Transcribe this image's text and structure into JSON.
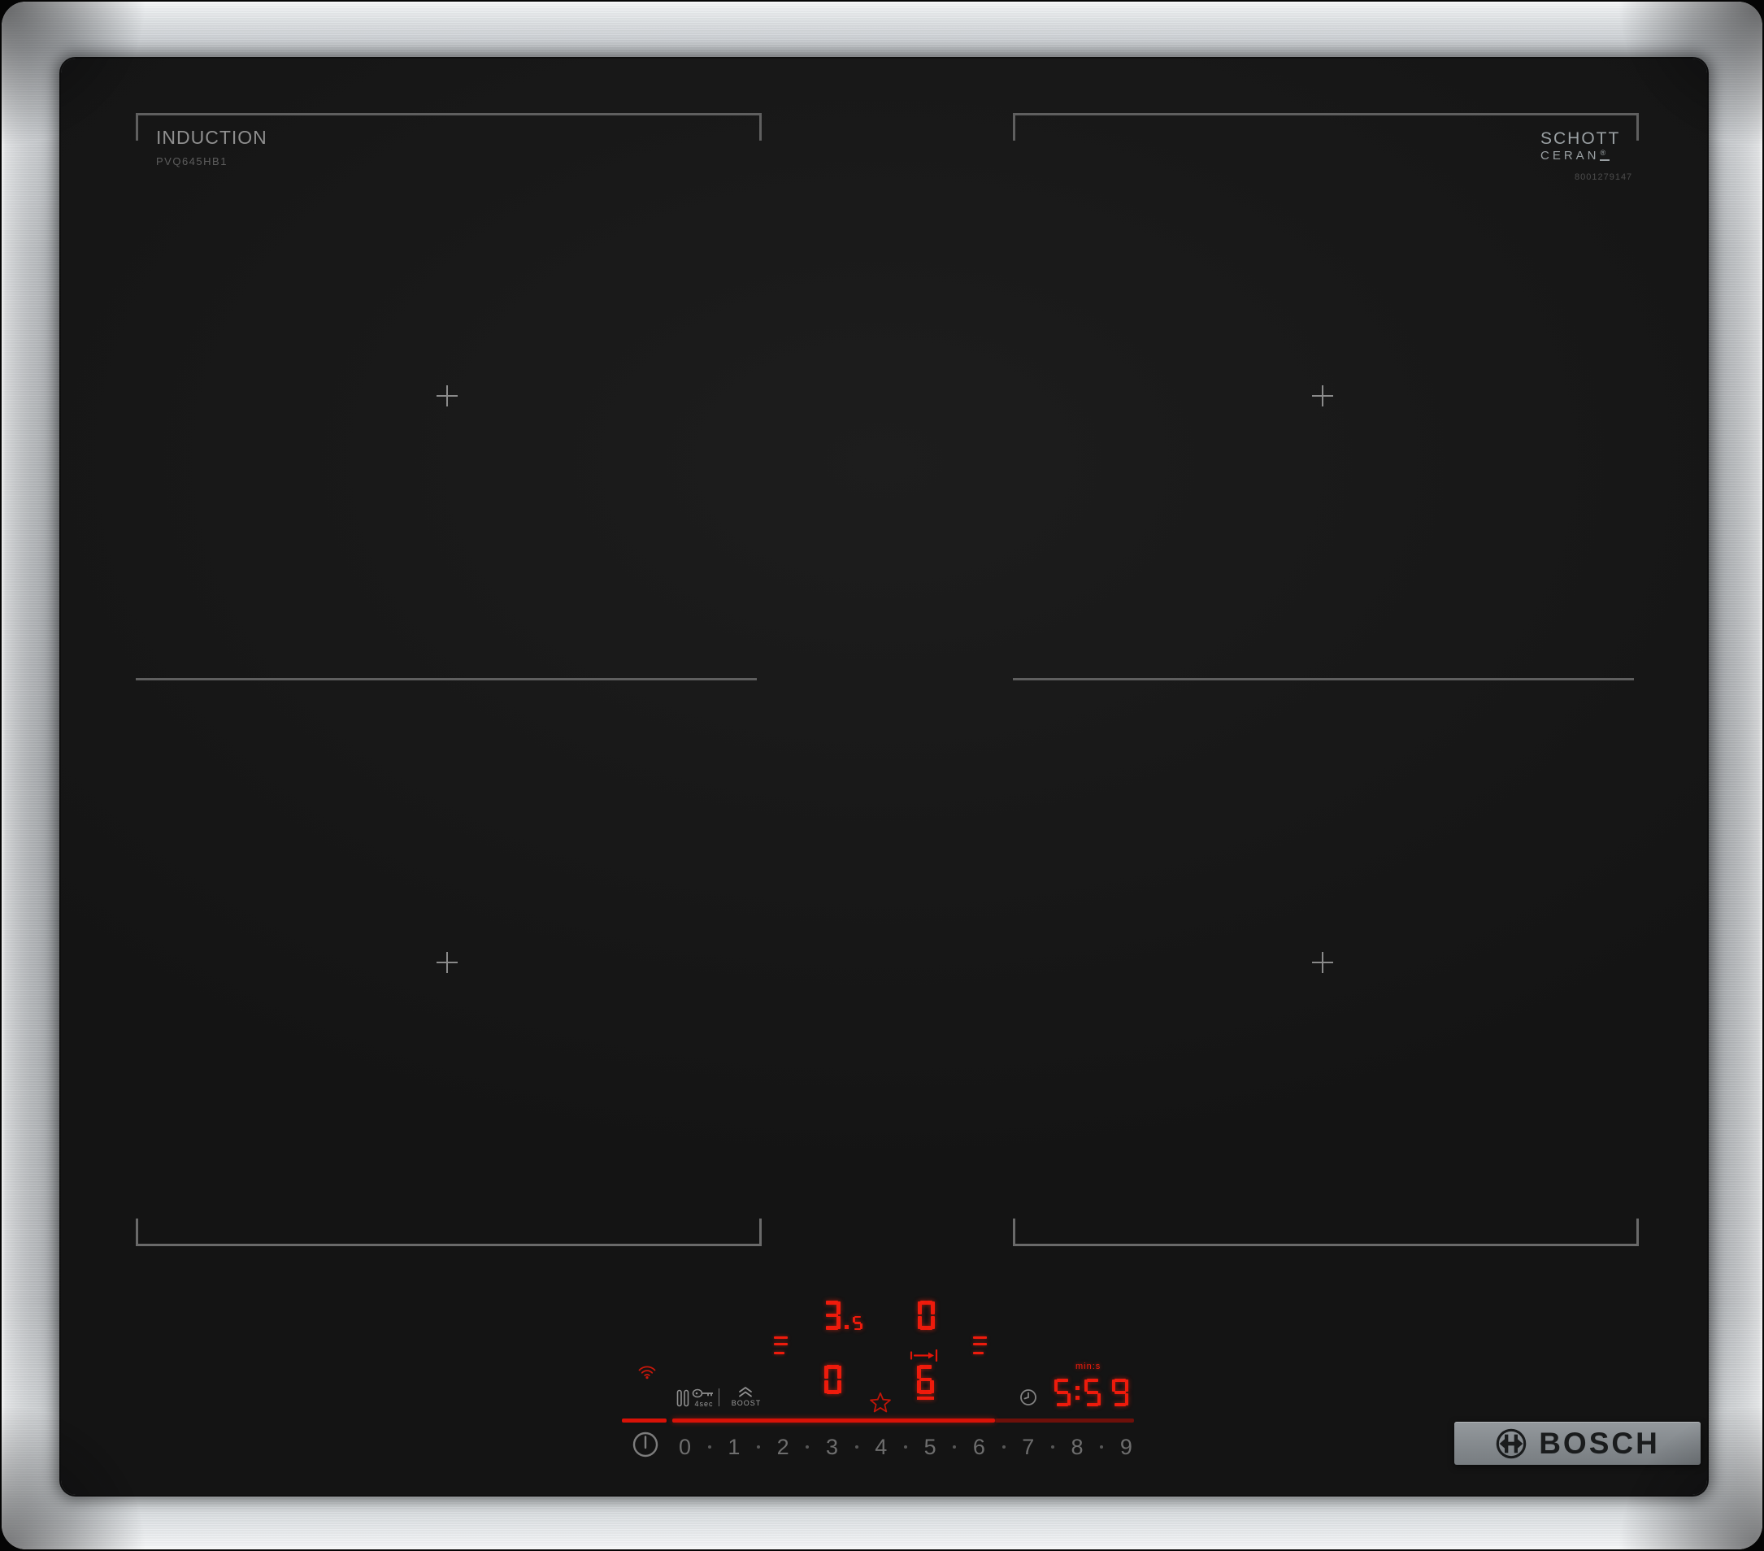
{
  "product": {
    "type_label": "INDUCTION",
    "model": "PVQ645HB1",
    "glass_brand_line1": "SCHOTT",
    "glass_brand_line2": "CERAN",
    "glass_brand_reg": "®",
    "print_number": "8001279147",
    "brand": "BOSCH"
  },
  "displays": {
    "rear_left_level": "3.5",
    "rear_right_level": "0",
    "front_left_level": "0",
    "front_right_level": "6",
    "timer": "5:59",
    "timer_unit": "min:s"
  },
  "controls": {
    "pause_hold_label": "4sec",
    "boost_label": "BOOST",
    "power_scale": [
      "0",
      "1",
      "2",
      "3",
      "4",
      "5",
      "6",
      "7",
      "8",
      "9"
    ]
  },
  "icons": {
    "wifi": "wifi-icon",
    "pause": "pause-icon",
    "child_lock": "key-icon",
    "boost": "double-chevron-up-icon",
    "move_zone": "arrow-to-bar-icon",
    "favorite": "star-icon",
    "timer": "clock-icon",
    "power": "power-icon",
    "zone_indicator": "dashes-icon",
    "brand_emblem": "bosch-armature-icon"
  },
  "colors": {
    "led_red": "#ee1b0c",
    "icon_gray": "#9a9a9a",
    "zone_line": "#5f5f5f",
    "glass": "#181818",
    "steel": "#9da1a5",
    "logo_plate": "#84898d"
  }
}
